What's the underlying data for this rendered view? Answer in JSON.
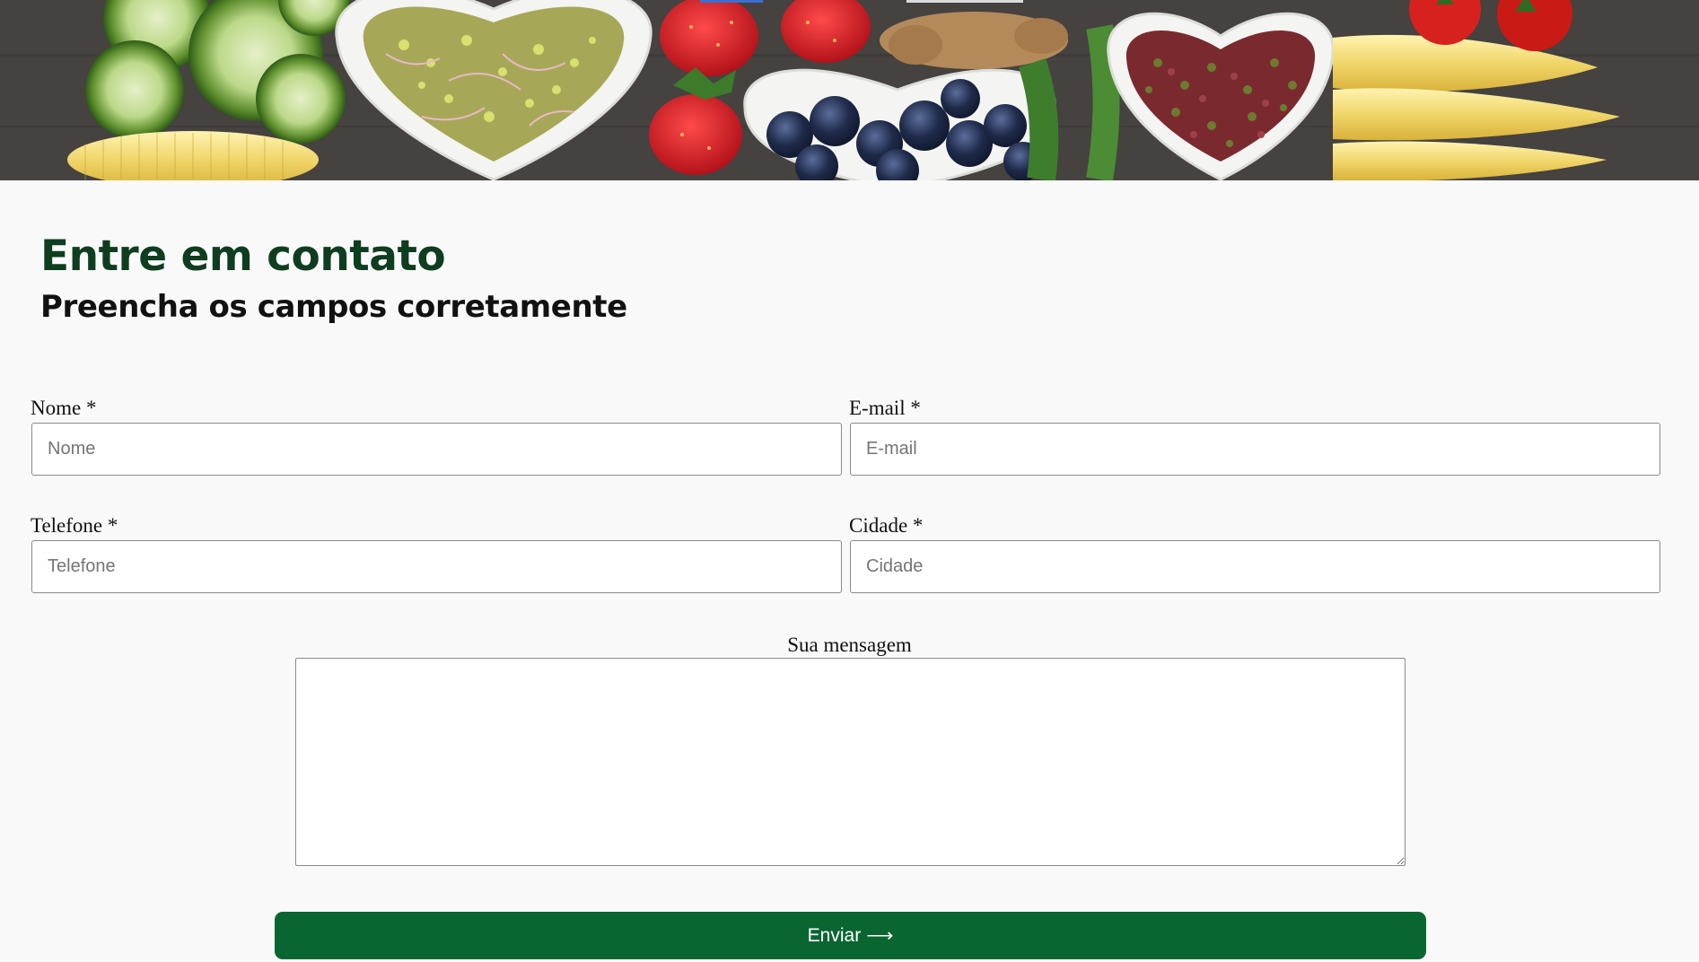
{
  "hero": {
    "image": "fresh-vegetables-banner"
  },
  "header": {
    "title": "Entre em contato",
    "subtitle": "Preencha os campos corretamente"
  },
  "form": {
    "name": {
      "label": "Nome *",
      "placeholder": "Nome"
    },
    "email": {
      "label": "E-mail *",
      "placeholder": "E-mail"
    },
    "phone": {
      "label": "Telefone *",
      "placeholder": "Telefone"
    },
    "city": {
      "label": "Cidade *",
      "placeholder": "Cidade"
    },
    "message": {
      "label": "Sua mensagem",
      "value": ""
    },
    "submit": {
      "label": "Enviar",
      "icon": "arrow-right-icon",
      "arrow": "⟶"
    }
  },
  "colors": {
    "title": "#0f3d1f",
    "button": "#0a6631",
    "page_background": "#f9f9f9"
  }
}
